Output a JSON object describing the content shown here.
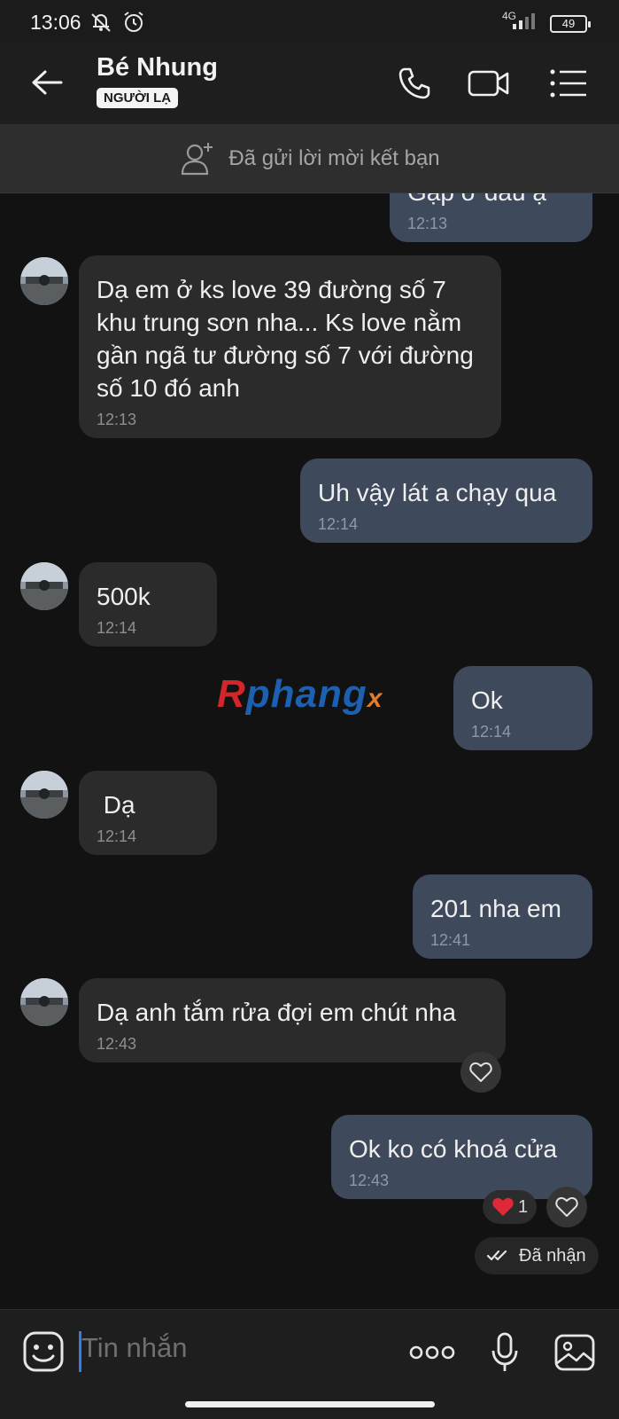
{
  "status_bar": {
    "time": "13:06",
    "network": "4G",
    "battery": "49",
    "icons": [
      "mute-icon",
      "alarm-icon",
      "signal-icon",
      "battery-icon"
    ]
  },
  "header": {
    "contact_name": "Bé Nhung",
    "badge": "NGƯỜI LẠ",
    "icons": [
      "back-arrow-icon",
      "phone-icon",
      "video-call-icon",
      "menu-list-icon"
    ]
  },
  "friend_bar": {
    "text": "Đã gửi lời mời kết bạn"
  },
  "messages": [
    {
      "dir": "out",
      "text": "Gặp ở đâu ạ",
      "time": "12:13"
    },
    {
      "dir": "in",
      "text": "Dạ em ở ks love 39 đường số 7 khu trung sơn nha... Ks love nằm gần ngã tư đường số 7 với đường số 10 đó anh",
      "time": "12:13"
    },
    {
      "dir": "out",
      "text": "Uh vậy lát a chạy qua",
      "time": "12:14"
    },
    {
      "dir": "in",
      "text": "500k",
      "time": "12:14"
    },
    {
      "dir": "out",
      "text": "Ok",
      "time": "12:14"
    },
    {
      "dir": "in",
      "text": " Dạ",
      "time": "12:14"
    },
    {
      "dir": "out",
      "text": "201 nha em",
      "time": "12:41"
    },
    {
      "dir": "in",
      "text": "Dạ anh tắm rửa đợi em chút nha",
      "time": "12:43"
    },
    {
      "dir": "out",
      "text": "Ok ko có khoá cửa",
      "time": "12:43"
    }
  ],
  "reaction": {
    "count": "1"
  },
  "delivery_status": "Đã nhận",
  "watermark": {
    "part1": "R",
    "part2": "phang",
    "part3": "x"
  },
  "input": {
    "placeholder": "Tin nhắn"
  },
  "colors": {
    "background": "#121212",
    "bubble_in": "#2b2b2b",
    "bubble_out": "#3e4a5b",
    "cursor": "#2f7cf0",
    "heart": "#e0283a"
  }
}
